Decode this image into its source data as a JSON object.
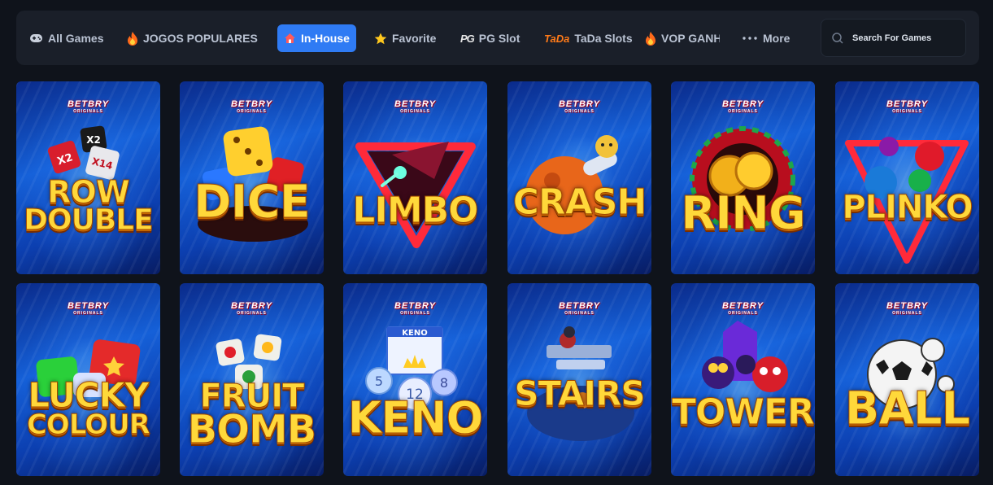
{
  "nav": {
    "tabs": [
      {
        "label": "All Games",
        "icon": "gamepad-icon"
      },
      {
        "label": "JOGOS POPULARES",
        "icon": "fire-icon"
      },
      {
        "label": "In-House",
        "icon": "house-icon",
        "active": true
      },
      {
        "label": "Favorite",
        "icon": "star-icon"
      },
      {
        "label": "PG Slot",
        "icon": "pg-logo-icon"
      },
      {
        "label": "TaDa Slots",
        "icon": "tada-logo-icon"
      },
      {
        "label": "VOP GANH",
        "icon": "fire-icon"
      },
      {
        "label": "More",
        "icon": "more-dots-icon"
      }
    ],
    "pg_icon_text": "PG",
    "tada_icon_text": "TaDa"
  },
  "search": {
    "placeholder": "Search For Games"
  },
  "brand": {
    "logo_text": "BETBRY",
    "logo_sub": "ORIGINALS"
  },
  "games": [
    {
      "line1": "ROW",
      "line2": "DOUBLE"
    },
    {
      "line1": "DICE",
      "line2": ""
    },
    {
      "line1": "LIMBO",
      "line2": ""
    },
    {
      "line1": "CRASH",
      "line2": ""
    },
    {
      "line1": "RING",
      "line2": ""
    },
    {
      "line1": "PLINKO",
      "line2": ""
    },
    {
      "line1": "LUCKY",
      "line2": "COLOUR"
    },
    {
      "line1": "FRUIT",
      "line2": "BOMB"
    },
    {
      "line1": "KENO",
      "line2": ""
    },
    {
      "line1": "STAIRS",
      "line2": ""
    },
    {
      "line1": "TOWER",
      "line2": ""
    },
    {
      "line1": "BALL",
      "line2": ""
    }
  ],
  "art_text": {
    "dice_x2a": "X2",
    "dice_x2b": "X2",
    "dice_x14": "X14",
    "keno_banner": "KENO",
    "keno_ball_a": "5",
    "keno_ball_b": "12",
    "keno_ball_c": "8"
  },
  "colors": {
    "accent": "#2f7bf4",
    "title_gold": "#ffd83a",
    "background": "#0f131b",
    "nav_bg": "#1a1f29"
  }
}
